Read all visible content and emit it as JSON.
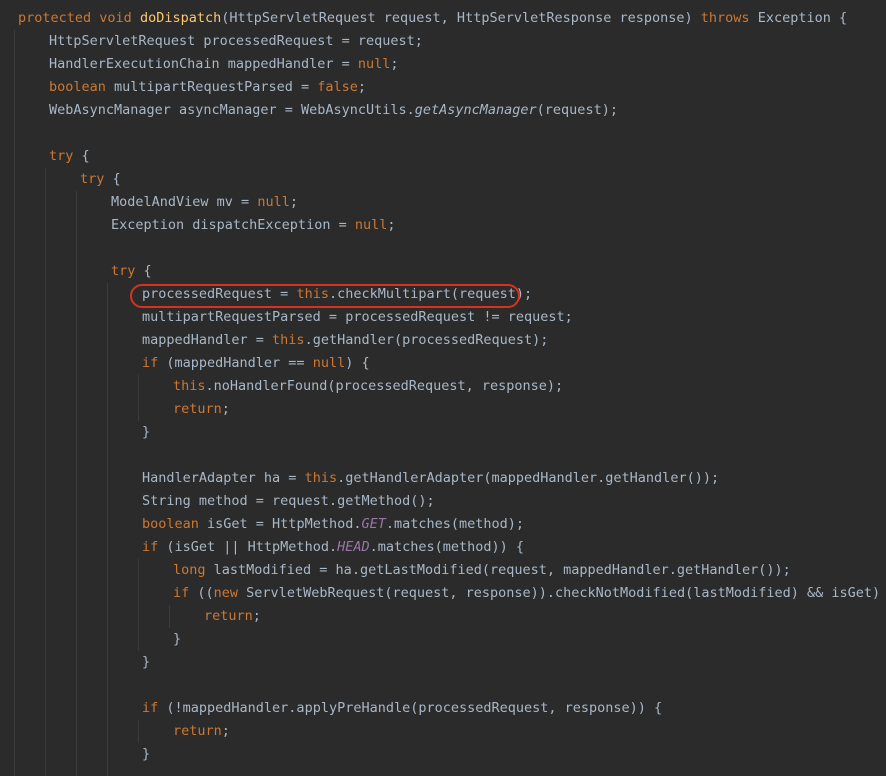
{
  "editor": {
    "colors": {
      "background": "#2b2b2b",
      "text": "#a9b7c6",
      "keyword": "#cc7832",
      "method_declaration": "#ffc66d",
      "static_field": "#9876aa",
      "highlight": "#d8321f"
    },
    "highlighted_line": 13,
    "lines": [
      {
        "indent": 0,
        "tokens": [
          {
            "t": "protected",
            "c": "kw"
          },
          {
            "t": " "
          },
          {
            "t": "void",
            "c": "kw"
          },
          {
            "t": " "
          },
          {
            "t": "doDispatch",
            "c": "fn"
          },
          {
            "t": "(HttpServletRequest request, HttpServletResponse response) "
          },
          {
            "t": "throws",
            "c": "kw"
          },
          {
            "t": " Exception {"
          }
        ]
      },
      {
        "indent": 1,
        "tokens": [
          {
            "t": "HttpServletRequest processedRequest = request;"
          }
        ]
      },
      {
        "indent": 1,
        "tokens": [
          {
            "t": "HandlerExecutionChain mappedHandler = "
          },
          {
            "t": "null",
            "c": "kw"
          },
          {
            "t": ";"
          }
        ]
      },
      {
        "indent": 1,
        "tokens": [
          {
            "t": "boolean",
            "c": "kw"
          },
          {
            "t": " multipartRequestParsed = "
          },
          {
            "t": "false",
            "c": "kw"
          },
          {
            "t": ";"
          }
        ]
      },
      {
        "indent": 1,
        "tokens": [
          {
            "t": "WebAsyncManager asyncManager = WebAsyncUtils."
          },
          {
            "t": "getAsyncManager",
            "c": "it"
          },
          {
            "t": "(request);"
          }
        ]
      },
      {
        "indent": 0,
        "tokens": []
      },
      {
        "indent": 1,
        "tokens": [
          {
            "t": "try",
            "c": "kw"
          },
          {
            "t": " {"
          }
        ]
      },
      {
        "indent": 2,
        "tokens": [
          {
            "t": "try",
            "c": "kw"
          },
          {
            "t": " {"
          }
        ]
      },
      {
        "indent": 3,
        "tokens": [
          {
            "t": "ModelAndView mv = "
          },
          {
            "t": "null",
            "c": "kw"
          },
          {
            "t": ";"
          }
        ]
      },
      {
        "indent": 3,
        "tokens": [
          {
            "t": "Exception dispatchException = "
          },
          {
            "t": "null",
            "c": "kw"
          },
          {
            "t": ";"
          }
        ]
      },
      {
        "indent": 0,
        "tokens": []
      },
      {
        "indent": 3,
        "tokens": [
          {
            "t": "try",
            "c": "kw"
          },
          {
            "t": " {"
          }
        ]
      },
      {
        "indent": 4,
        "tokens": [
          {
            "t": "processedRequest = "
          },
          {
            "t": "this",
            "c": "kw"
          },
          {
            "t": ".checkMultipart(request);"
          }
        ]
      },
      {
        "indent": 4,
        "tokens": [
          {
            "t": "multipartRequestParsed = processedRequest != request;"
          }
        ]
      },
      {
        "indent": 4,
        "tokens": [
          {
            "t": "mappedHandler = "
          },
          {
            "t": "this",
            "c": "kw"
          },
          {
            "t": ".getHandler(processedRequest);"
          }
        ]
      },
      {
        "indent": 4,
        "tokens": [
          {
            "t": "if",
            "c": "kw"
          },
          {
            "t": " (mappedHandler == "
          },
          {
            "t": "null",
            "c": "kw"
          },
          {
            "t": ") {"
          }
        ]
      },
      {
        "indent": 5,
        "tokens": [
          {
            "t": "this",
            "c": "kw"
          },
          {
            "t": ".noHandlerFound(processedRequest, response);"
          }
        ]
      },
      {
        "indent": 5,
        "tokens": [
          {
            "t": "return",
            "c": "kw"
          },
          {
            "t": ";"
          }
        ]
      },
      {
        "indent": 4,
        "tokens": [
          {
            "t": "}"
          }
        ]
      },
      {
        "indent": 0,
        "tokens": []
      },
      {
        "indent": 4,
        "tokens": [
          {
            "t": "HandlerAdapter ha = "
          },
          {
            "t": "this",
            "c": "kw"
          },
          {
            "t": ".getHandlerAdapter(mappedHandler.getHandler());"
          }
        ]
      },
      {
        "indent": 4,
        "tokens": [
          {
            "t": "String method = request.getMethod();"
          }
        ]
      },
      {
        "indent": 4,
        "tokens": [
          {
            "t": "boolean",
            "c": "kw"
          },
          {
            "t": " isGet = HttpMethod."
          },
          {
            "t": "GET",
            "c": "st"
          },
          {
            "t": ".matches(method);"
          }
        ]
      },
      {
        "indent": 4,
        "tokens": [
          {
            "t": "if",
            "c": "kw"
          },
          {
            "t": " (isGet || HttpMethod."
          },
          {
            "t": "HEAD",
            "c": "st"
          },
          {
            "t": ".matches(method)) {"
          }
        ]
      },
      {
        "indent": 5,
        "tokens": [
          {
            "t": "long",
            "c": "kw"
          },
          {
            "t": " lastModified = ha.getLastModified(request, mappedHandler.getHandler());"
          }
        ]
      },
      {
        "indent": 5,
        "tokens": [
          {
            "t": "if",
            "c": "kw"
          },
          {
            "t": " (("
          },
          {
            "t": "new",
            "c": "kw"
          },
          {
            "t": " ServletWebRequest(request, response)).checkNotModified(lastModified) && isGet) {"
          }
        ]
      },
      {
        "indent": 6,
        "tokens": [
          {
            "t": "return",
            "c": "kw"
          },
          {
            "t": ";"
          }
        ]
      },
      {
        "indent": 5,
        "tokens": [
          {
            "t": "}"
          }
        ]
      },
      {
        "indent": 4,
        "tokens": [
          {
            "t": "}"
          }
        ]
      },
      {
        "indent": 0,
        "tokens": []
      },
      {
        "indent": 4,
        "tokens": [
          {
            "t": "if",
            "c": "kw"
          },
          {
            "t": " (!mappedHandler.applyPreHandle(processedRequest, response)) {"
          }
        ]
      },
      {
        "indent": 5,
        "tokens": [
          {
            "t": "return",
            "c": "kw"
          },
          {
            "t": ";"
          }
        ]
      },
      {
        "indent": 4,
        "tokens": [
          {
            "t": "}"
          }
        ]
      }
    ]
  }
}
